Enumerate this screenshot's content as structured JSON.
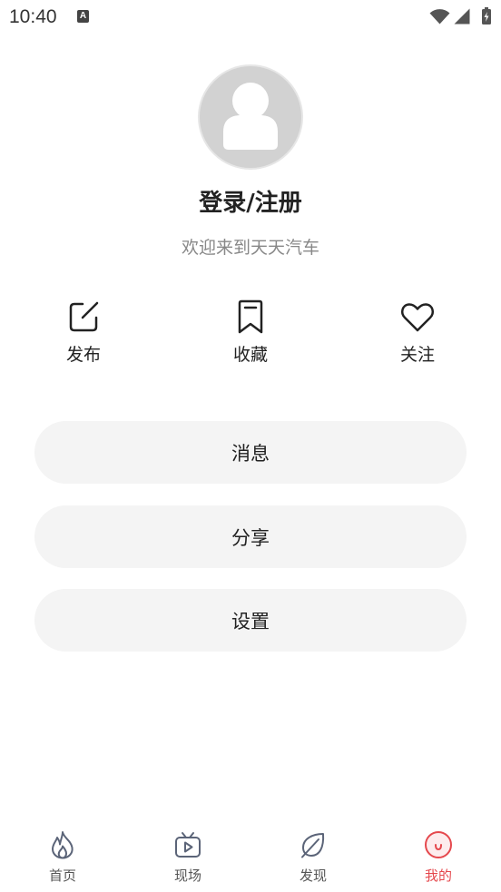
{
  "status_bar": {
    "time": "10:40",
    "notification_glyph": "A",
    "icons": [
      "a-notification-icon",
      "wifi-icon",
      "cell-signal-icon",
      "battery-charging-icon"
    ]
  },
  "profile": {
    "avatar_icon": "default-avatar-icon",
    "title": "登录/注册",
    "subtitle": "欢迎来到天天汽车"
  },
  "actions": [
    {
      "label": "发布",
      "icon": "edit-icon"
    },
    {
      "label": "收藏",
      "icon": "bookmark-icon"
    },
    {
      "label": "关注",
      "icon": "heart-icon"
    }
  ],
  "menu": [
    {
      "label": "消息"
    },
    {
      "label": "分享"
    },
    {
      "label": "设置"
    }
  ],
  "bottom_nav": {
    "items": [
      {
        "label": "首页",
        "icon": "fire-icon",
        "active": false
      },
      {
        "label": "现场",
        "icon": "tv-play-icon",
        "active": false
      },
      {
        "label": "发现",
        "icon": "leaf-icon",
        "active": false
      },
      {
        "label": "我的",
        "icon": "profile-smile-icon",
        "active": true
      }
    ]
  },
  "colors": {
    "accent": "#e5484d",
    "text": "#222222",
    "muted": "#888888",
    "pill": "#f4f4f4",
    "nav_icon": "#5b6478",
    "nav_label": "#555555"
  }
}
